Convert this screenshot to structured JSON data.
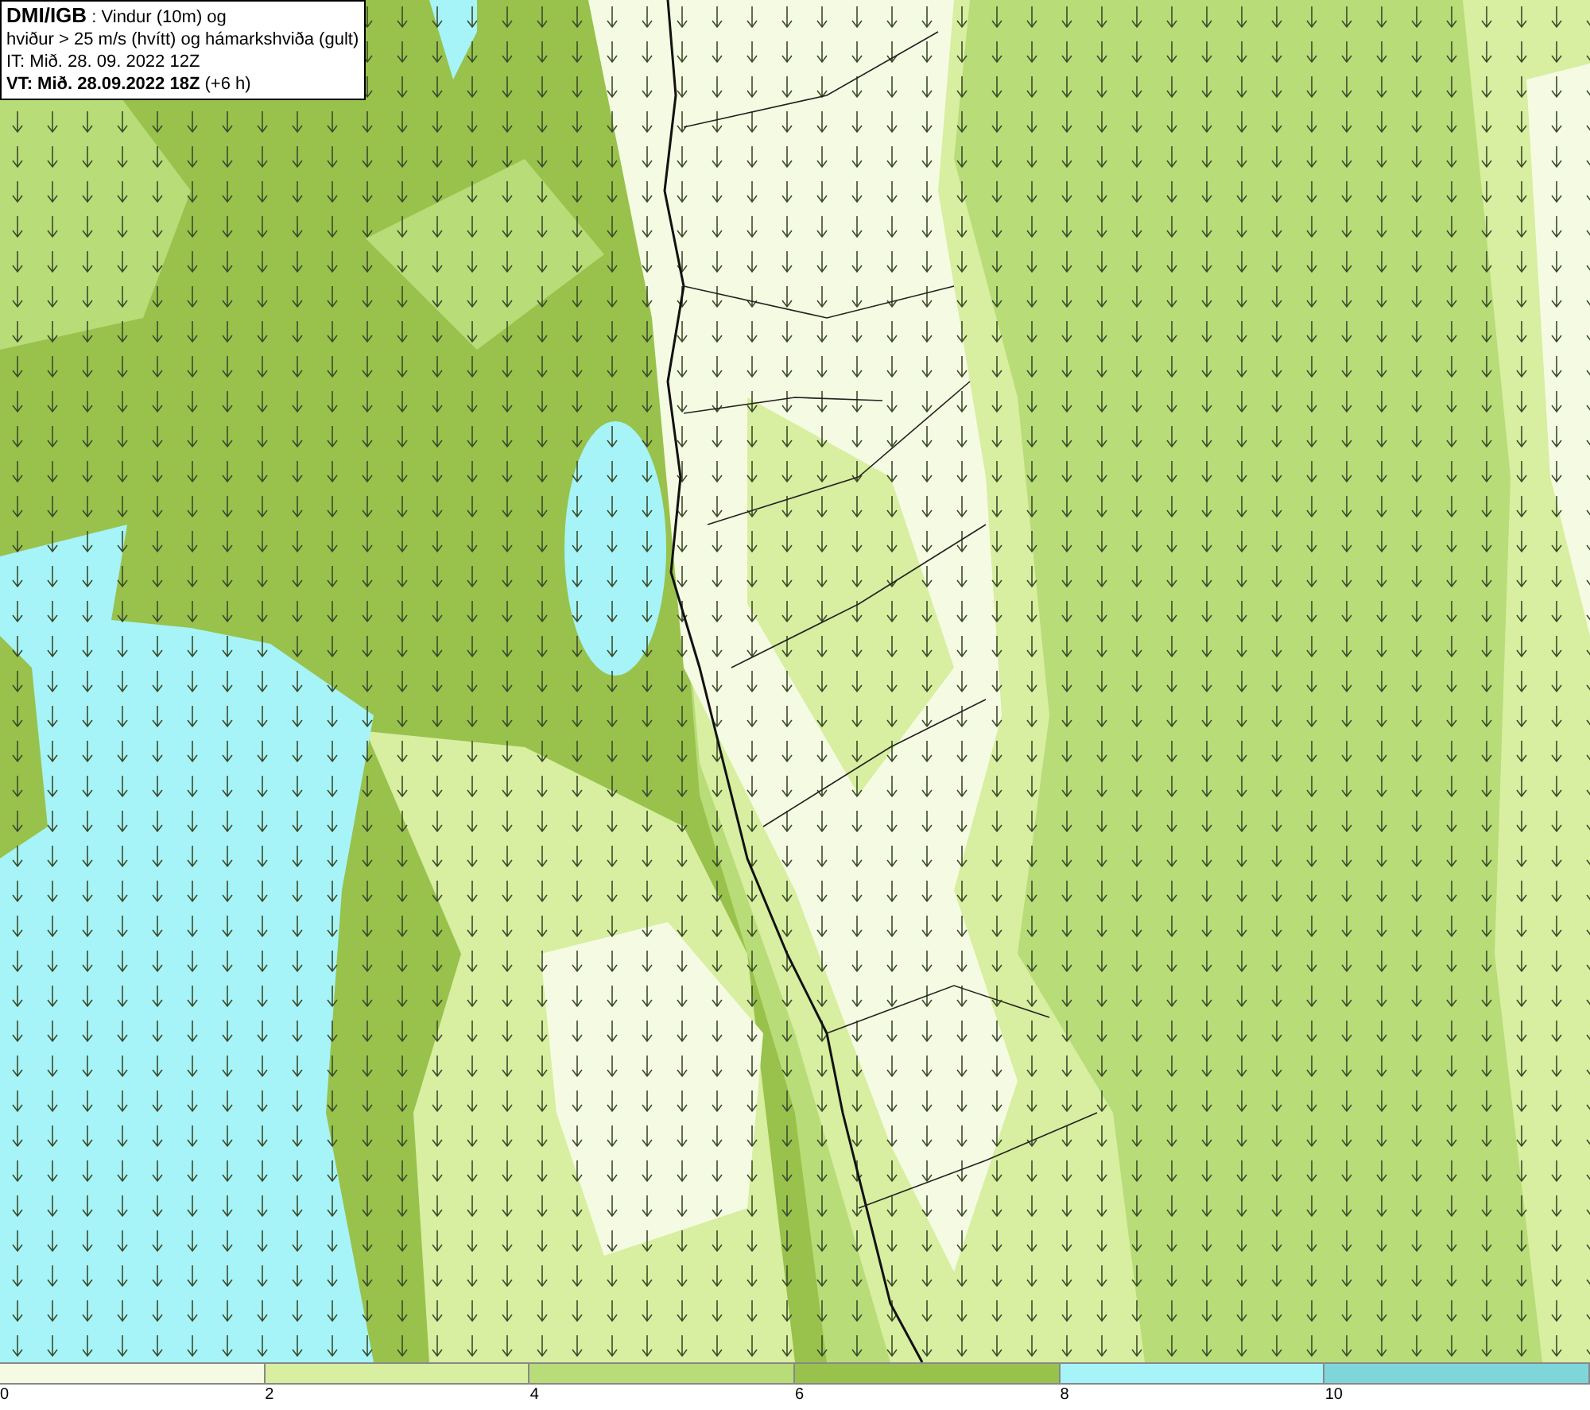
{
  "info_box": {
    "lines": [
      "**DMI/IGB** : Vindur (10m) og",
      "hviður > 25 m/s (hvítt) og hámarkshviða (gult)",
      "IT: Mið. 28. 09. 2022 12Z",
      "**VT: Mið. 28.09.2022 18Z** (+6 h)"
    ]
  },
  "legend": {
    "bins": [
      {
        "color": "#f5fbe2"
      },
      {
        "color": "#d8eea0"
      },
      {
        "color": "#b8dc78"
      },
      {
        "color": "#98c24c"
      },
      {
        "color": "#a6f4f8"
      },
      {
        "color": "#7fd6da"
      }
    ],
    "ticks": [
      "0",
      "2",
      "4",
      "6",
      "8",
      "10"
    ]
  }
}
